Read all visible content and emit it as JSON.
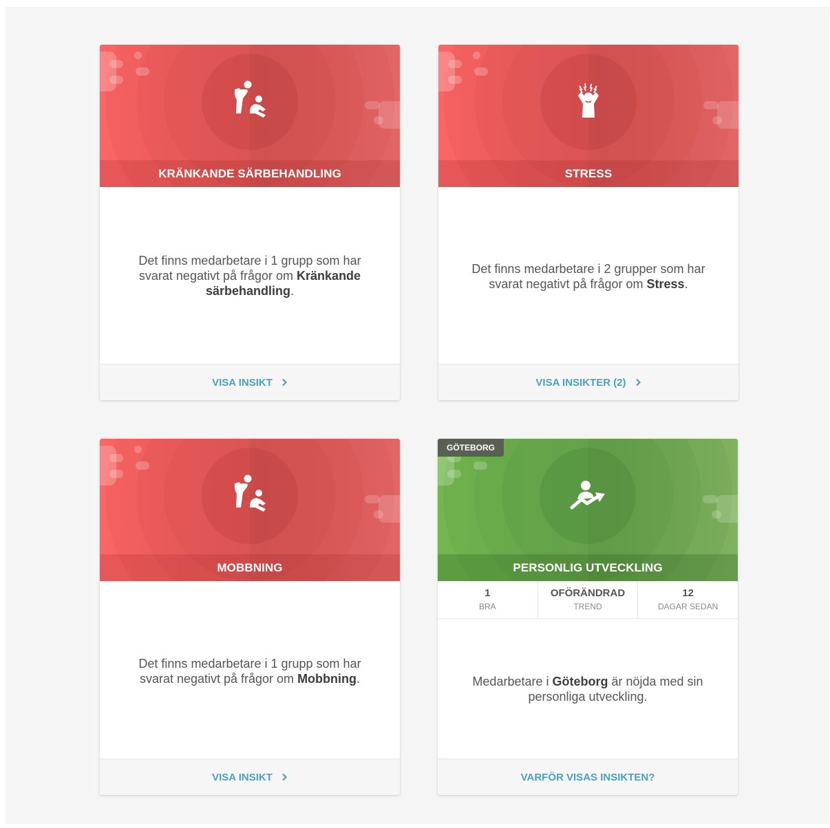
{
  "cards": [
    {
      "title": "KRÄNKANDE SÄRBEHANDLING",
      "icon": "harassment-icon",
      "text_before": "Det finns medarbetare i 1 grupp som har svarat negativt på frågor om ",
      "text_bold": "Kränkande särbehandling",
      "text_after": ".",
      "footer_label": "VISA INSIKT"
    },
    {
      "title": "STRESS",
      "icon": "stress-icon",
      "text_before": "Det finns medarbetare i 2 grupper som har svarat negativt på frågor om ",
      "text_bold": "Stress",
      "text_after": ".",
      "footer_label": "VISA INSIKTER (2)"
    },
    {
      "title": "MOBBNING",
      "icon": "harassment-icon",
      "text_before": "Det finns medarbetare i 1 grupp som har svarat negativt på frågor om ",
      "text_bold": "Mobbning",
      "text_after": ".",
      "footer_label": "VISA INSIKT"
    },
    {
      "tag": "GÖTEBORG",
      "title": "PERSONLIG UTVECKLING",
      "icon": "personal-growth-icon",
      "stats": [
        {
          "value": "1",
          "label": "BRA"
        },
        {
          "value": "OFÖRÄNDRAD",
          "label": "TREND"
        },
        {
          "value": "12",
          "label": "DAGAR SEDAN"
        }
      ],
      "text_before": "Medarbetare i ",
      "text_bold": "Göteborg",
      "text_after": " är nöjda med sin personliga utveckling.",
      "footer_label": "VARFÖR VISAS INSIKTEN?"
    }
  ],
  "colors": {
    "alert": "#fb6565",
    "positive": "#72b64f",
    "link": "#4aa0bd"
  }
}
